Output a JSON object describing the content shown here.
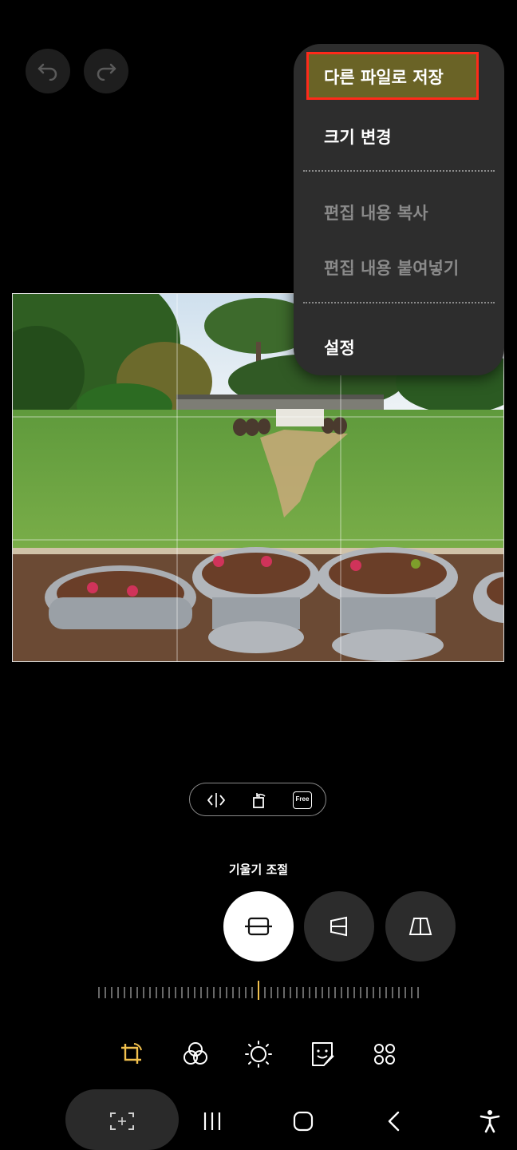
{
  "top_bar": {
    "undo_icon": "undo-icon",
    "redo_icon": "redo-icon"
  },
  "menu": {
    "items": [
      {
        "label": "다른 파일로 저장",
        "enabled": true,
        "highlighted": true
      },
      {
        "label": "크기 변경",
        "enabled": true
      },
      {
        "label": "편집 내용 복사",
        "enabled": false
      },
      {
        "label": "편집 내용 붙여넣기",
        "enabled": false
      },
      {
        "label": "설정",
        "enabled": true
      }
    ],
    "highlight_color": "#ff2a1a"
  },
  "photo": {
    "description_icon": "garden-photo"
  },
  "crop_tools": {
    "free_label": "Free"
  },
  "tilt": {
    "label": "기울기 조절",
    "modes": [
      "straighten-icon",
      "vertical-perspective-icon",
      "horizontal-perspective-icon"
    ],
    "selected_mode": 0
  },
  "bottom_tools": [
    "crop-rotate-icon",
    "filters-icon",
    "brightness-icon",
    "stickers-icon",
    "more-icon"
  ],
  "colors": {
    "accent": "#f2c14e",
    "background": "#000000",
    "menu_bg": "#2d2d2d"
  }
}
